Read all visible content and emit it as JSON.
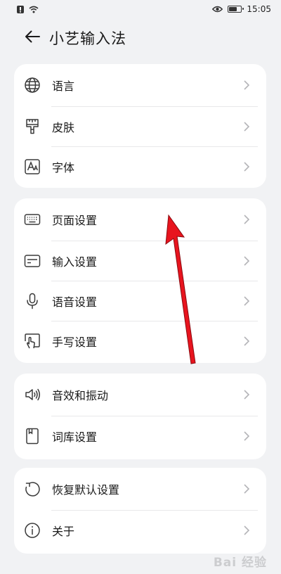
{
  "status_bar": {
    "time": "15:05",
    "icons": [
      "alert-icon",
      "wifi-icon",
      "eye-icon",
      "battery-icon"
    ],
    "battery_level": 0.7
  },
  "header": {
    "back_icon": "arrow-left-icon",
    "title": "小艺输入法"
  },
  "groups": [
    {
      "items": [
        {
          "label": "语言",
          "icon": "globe-icon"
        },
        {
          "label": "皮肤",
          "icon": "brush-icon"
        },
        {
          "label": "字体",
          "icon": "font-icon"
        }
      ]
    },
    {
      "items": [
        {
          "label": "页面设置",
          "icon": "keyboard-icon"
        },
        {
          "label": "输入设置",
          "icon": "input-box-icon"
        },
        {
          "label": "语音设置",
          "icon": "microphone-icon"
        },
        {
          "label": "手写设置",
          "icon": "handwriting-icon"
        }
      ]
    },
    {
      "items": [
        {
          "label": "音效和振动",
          "icon": "speaker-icon"
        },
        {
          "label": "词库设置",
          "icon": "dictionary-icon"
        }
      ]
    },
    {
      "items": [
        {
          "label": "恢复默认设置",
          "icon": "restore-icon"
        },
        {
          "label": "关于",
          "icon": "info-icon"
        }
      ]
    }
  ],
  "annotation": {
    "color": "#e8141e"
  },
  "watermark": "Bai 经验"
}
